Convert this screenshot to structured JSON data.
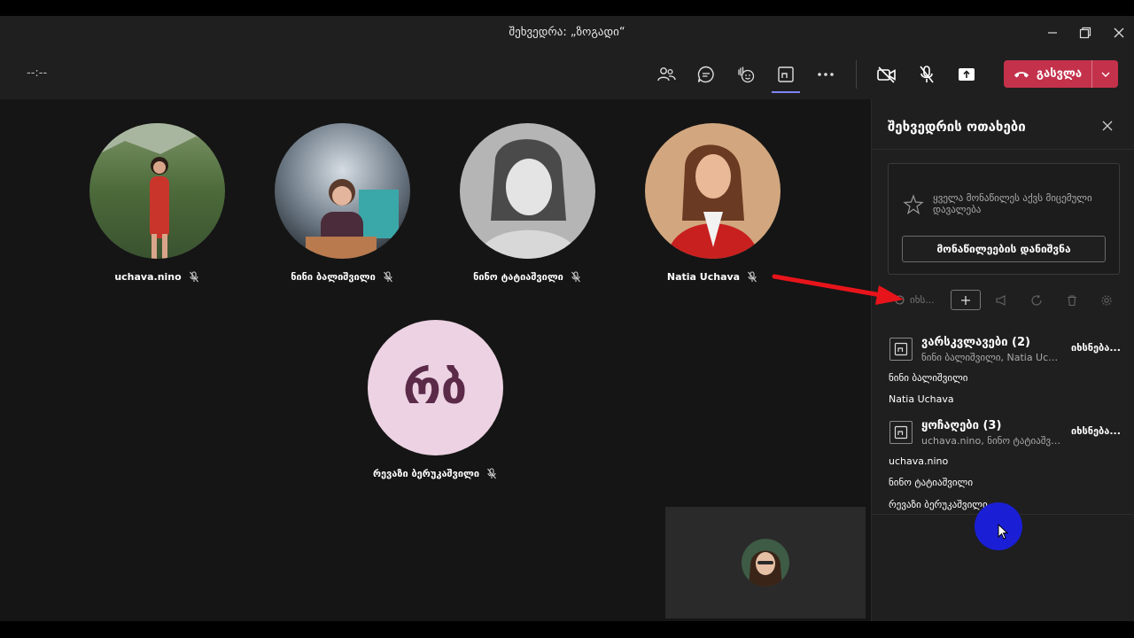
{
  "window": {
    "title": "შეხვედრა: „ზოგადი“",
    "minimize_icon": "minimize-icon",
    "maximize_icon": "restore-icon",
    "close_icon": "close-icon"
  },
  "toolbar": {
    "timer": "--:--",
    "buttons": [
      "people-icon",
      "chat-icon",
      "raise-hand-icon",
      "breakout-rooms-icon",
      "more-icon",
      "camera-off-icon",
      "mic-off-icon",
      "share-icon"
    ],
    "leave_label": "გასვლა"
  },
  "participants": [
    {
      "name": "uchava.nino"
    },
    {
      "name": "ნინი ბალიშვილი"
    },
    {
      "name": "ნინო ტატიაშვილი"
    },
    {
      "name": "Natia Uchava"
    },
    {
      "name": "რევაზი ბერუკაშვილი",
      "initials": "რბ"
    }
  ],
  "panel": {
    "title": "შეხვედრის ოთახები",
    "assign_text": "ყველა მონაწილეს აქვს მიცემული დავალება",
    "assign_button": "მონაწილეების დანიშვნა",
    "open_label": "იხს...",
    "rooms": [
      {
        "title": "ვარსკვლავები (2)",
        "subtitle": "ნინი ბალიშვილი, Natia Uch...",
        "status": "იხსნება...",
        "members": [
          "ნინი ბალიშვილი",
          "Natia Uchava"
        ]
      },
      {
        "title": "ყოჩაღები (3)",
        "subtitle": "uchava.nino, ნინო ტატიაშვი...",
        "status": "იხსნება...",
        "members": [
          "uchava.nino",
          "ნინო ტატიაშვილი",
          "რევაზი ბერუკაშვილი"
        ]
      }
    ]
  },
  "colors": {
    "leave_button": "#c4314b",
    "accent": "#7f85f5",
    "annotation_arrow": "#e8141b",
    "cursor_highlight": "#1a1fd6"
  }
}
